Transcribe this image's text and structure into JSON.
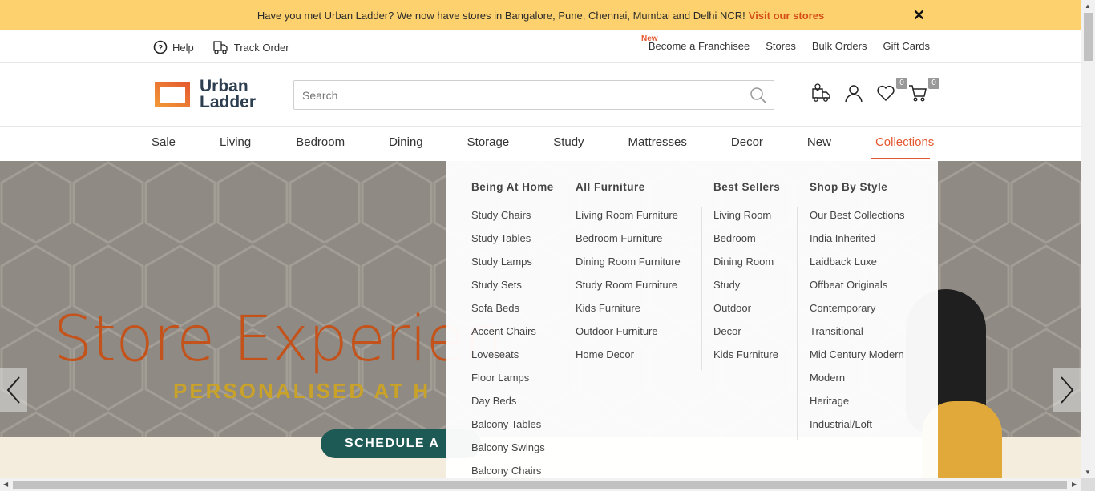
{
  "promo": {
    "text": "Have you met Urban Ladder? We now have stores in Bangalore, Pune, Chennai, Mumbai and Delhi NCR!",
    "link": "Visit our stores",
    "close": "✕"
  },
  "utility": {
    "help": "Help",
    "track": "Track Order",
    "new_badge": "New",
    "links": [
      "Become a Franchisee",
      "Stores",
      "Bulk Orders",
      "Gift Cards"
    ]
  },
  "header": {
    "logo_line1": "Urban",
    "logo_line2": "Ladder",
    "search_placeholder": "Search",
    "wishlist_count": "0",
    "cart_count": "0"
  },
  "nav": [
    "Sale",
    "Living",
    "Bedroom",
    "Dining",
    "Storage",
    "Study",
    "Mattresses",
    "Decor",
    "New",
    "Collections"
  ],
  "hero": {
    "title": "Store Experien",
    "subtitle": "PERSONALISED AT H",
    "cta": "SCHEDULE A"
  },
  "mega": {
    "columns": [
      {
        "heading": "Being At Home",
        "items": [
          "Study Chairs",
          "Study Tables",
          "Study Lamps",
          "Study Sets",
          "Sofa Beds",
          "Accent Chairs",
          "Loveseats",
          "Floor Lamps",
          "Day Beds",
          "Balcony Tables",
          "Balcony Swings",
          "Balcony Chairs"
        ]
      },
      {
        "heading": "All Furniture",
        "items": [
          "Living Room Furniture",
          "Bedroom Furniture",
          "Dining Room Furniture",
          "Study Room Furniture",
          "Kids Furniture",
          "Outdoor Furniture",
          "Home Decor"
        ]
      },
      {
        "heading": "Best Sellers",
        "items": [
          "Living Room",
          "Bedroom",
          "Dining Room",
          "Study",
          "Outdoor",
          "Decor",
          "Kids Furniture"
        ]
      },
      {
        "heading": "Shop By Style",
        "items": [
          "Our Best Collections",
          "India Inherited",
          "Laidback Luxe",
          "Offbeat Originals",
          "Contemporary",
          "Transitional",
          "Mid Century Modern",
          "Modern",
          "Heritage",
          "Industrial/Loft"
        ]
      }
    ]
  },
  "colors": {
    "promo_bg": "#fdd26e",
    "accent": "#e4572e",
    "brand_dark": "#2d3e50"
  }
}
